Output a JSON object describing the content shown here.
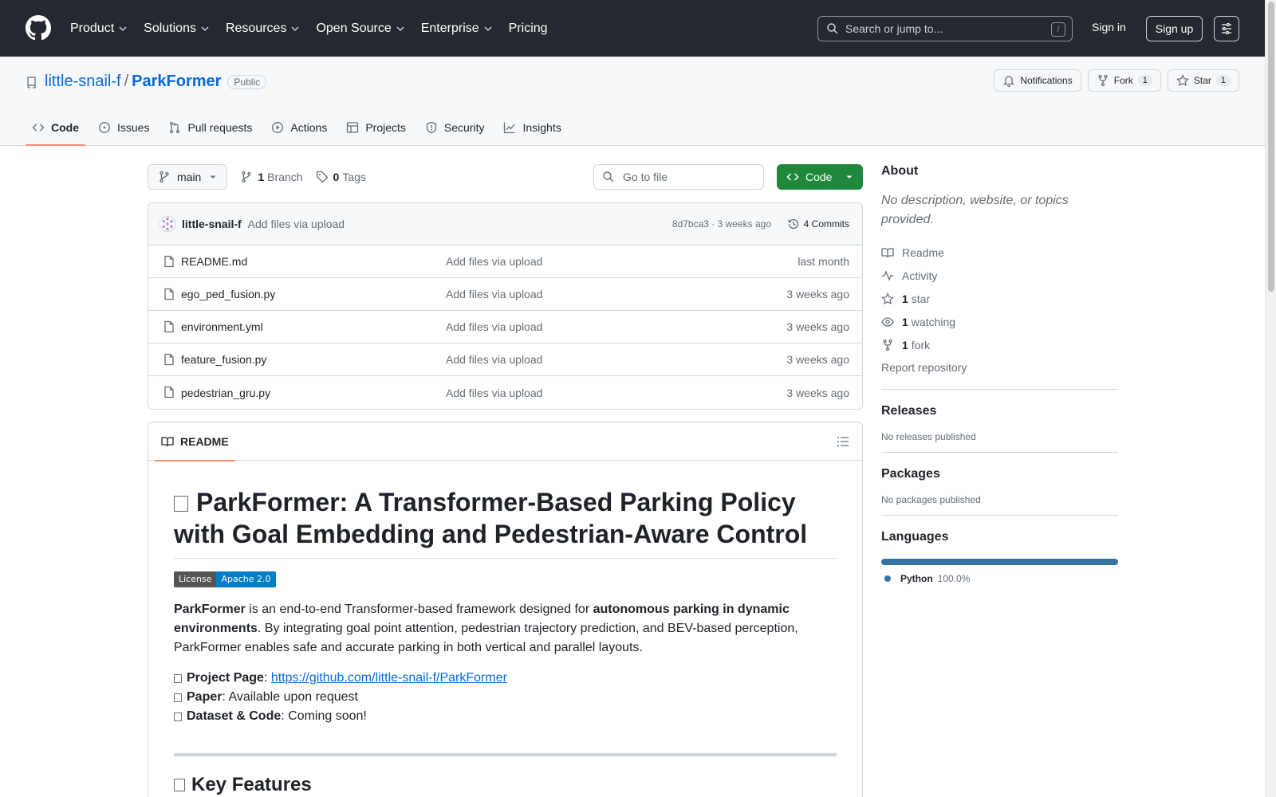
{
  "header": {
    "nav": [
      {
        "label": "Product",
        "dropdown": true
      },
      {
        "label": "Solutions",
        "dropdown": true
      },
      {
        "label": "Resources",
        "dropdown": true
      },
      {
        "label": "Open Source",
        "dropdown": true
      },
      {
        "label": "Enterprise",
        "dropdown": true
      },
      {
        "label": "Pricing",
        "dropdown": false
      }
    ],
    "search_placeholder": "Search or jump to...",
    "search_shortcut": "/",
    "sign_in": "Sign in",
    "sign_up": "Sign up"
  },
  "repo": {
    "owner": "little-snail-f",
    "separator": "/",
    "name": "ParkFormer",
    "visibility": "Public",
    "actions": {
      "notifications": "Notifications",
      "fork_label": "Fork",
      "fork_count": "1",
      "star_label": "Star",
      "star_count": "1"
    },
    "tabs": [
      {
        "label": "Code",
        "icon": "code-icon",
        "active": true
      },
      {
        "label": "Issues",
        "icon": "issue-icon",
        "active": false
      },
      {
        "label": "Pull requests",
        "icon": "pull-request-icon",
        "active": false
      },
      {
        "label": "Actions",
        "icon": "play-icon",
        "active": false
      },
      {
        "label": "Projects",
        "icon": "table-icon",
        "active": false
      },
      {
        "label": "Security",
        "icon": "shield-icon",
        "active": false
      },
      {
        "label": "Insights",
        "icon": "graph-icon",
        "active": false
      }
    ]
  },
  "toolbar": {
    "branch": "main",
    "branch_count": "1",
    "branch_label": "Branch",
    "tag_count": "0",
    "tag_label": "Tags",
    "goto_placeholder": "Go to file",
    "code_button": "Code"
  },
  "commit": {
    "author": "little-snail-f",
    "message": "Add files via upload",
    "meta": "8d7bca3 · 3 weeks ago",
    "count": "4 Commits"
  },
  "files": [
    {
      "name": "README.md",
      "message": "Add files via upload",
      "date": "last month"
    },
    {
      "name": "ego_ped_fusion.py",
      "message": "Add files via upload",
      "date": "3 weeks ago"
    },
    {
      "name": "environment.yml",
      "message": "Add files via upload",
      "date": "3 weeks ago"
    },
    {
      "name": "feature_fusion.py",
      "message": "Add files via upload",
      "date": "3 weeks ago"
    },
    {
      "name": "pedestrian_gru.py",
      "message": "Add files via upload",
      "date": "3 weeks ago"
    }
  ],
  "readme": {
    "tab": "README",
    "title": "ParkFormer: A Transformer-Based Parking Policy with Goal Embedding and Pedestrian-Aware Control",
    "badge_left": "License",
    "badge_right": "Apache 2.0",
    "intro_strong1": "ParkFormer",
    "intro_text1": " is an end-to-end Transformer-based framework designed for ",
    "intro_strong2": "autonomous parking in dynamic environments",
    "intro_text2": ". By integrating goal point attention, pedestrian trajectory prediction, and BEV-based perception, ParkFormer enables safe and accurate parking in both vertical and parallel layouts.",
    "list": {
      "project_label": "Project Page",
      "project_link": "https://github.com/little-snail-f/ParkFormer",
      "paper_label": "Paper",
      "paper_text": ": Available upon request",
      "dataset_label": "Dataset & Code",
      "dataset_text": ": Coming soon!",
      "colon": ": "
    },
    "features_heading": "Key Features"
  },
  "sidebar": {
    "about_title": "About",
    "about_desc": "No description, website, or topics provided.",
    "items": {
      "readme": "Readme",
      "activity": "Activity",
      "star_count": "1",
      "star_label": "star",
      "watch_count": "1",
      "watch_label": "watching",
      "fork_count": "1",
      "fork_label": "fork"
    },
    "report": "Report repository",
    "releases_title": "Releases",
    "releases_text": "No releases published",
    "packages_title": "Packages",
    "packages_text": "No packages published",
    "languages_title": "Languages",
    "language": {
      "name": "Python",
      "percent": "100.0%",
      "color": "#3572A5"
    }
  }
}
